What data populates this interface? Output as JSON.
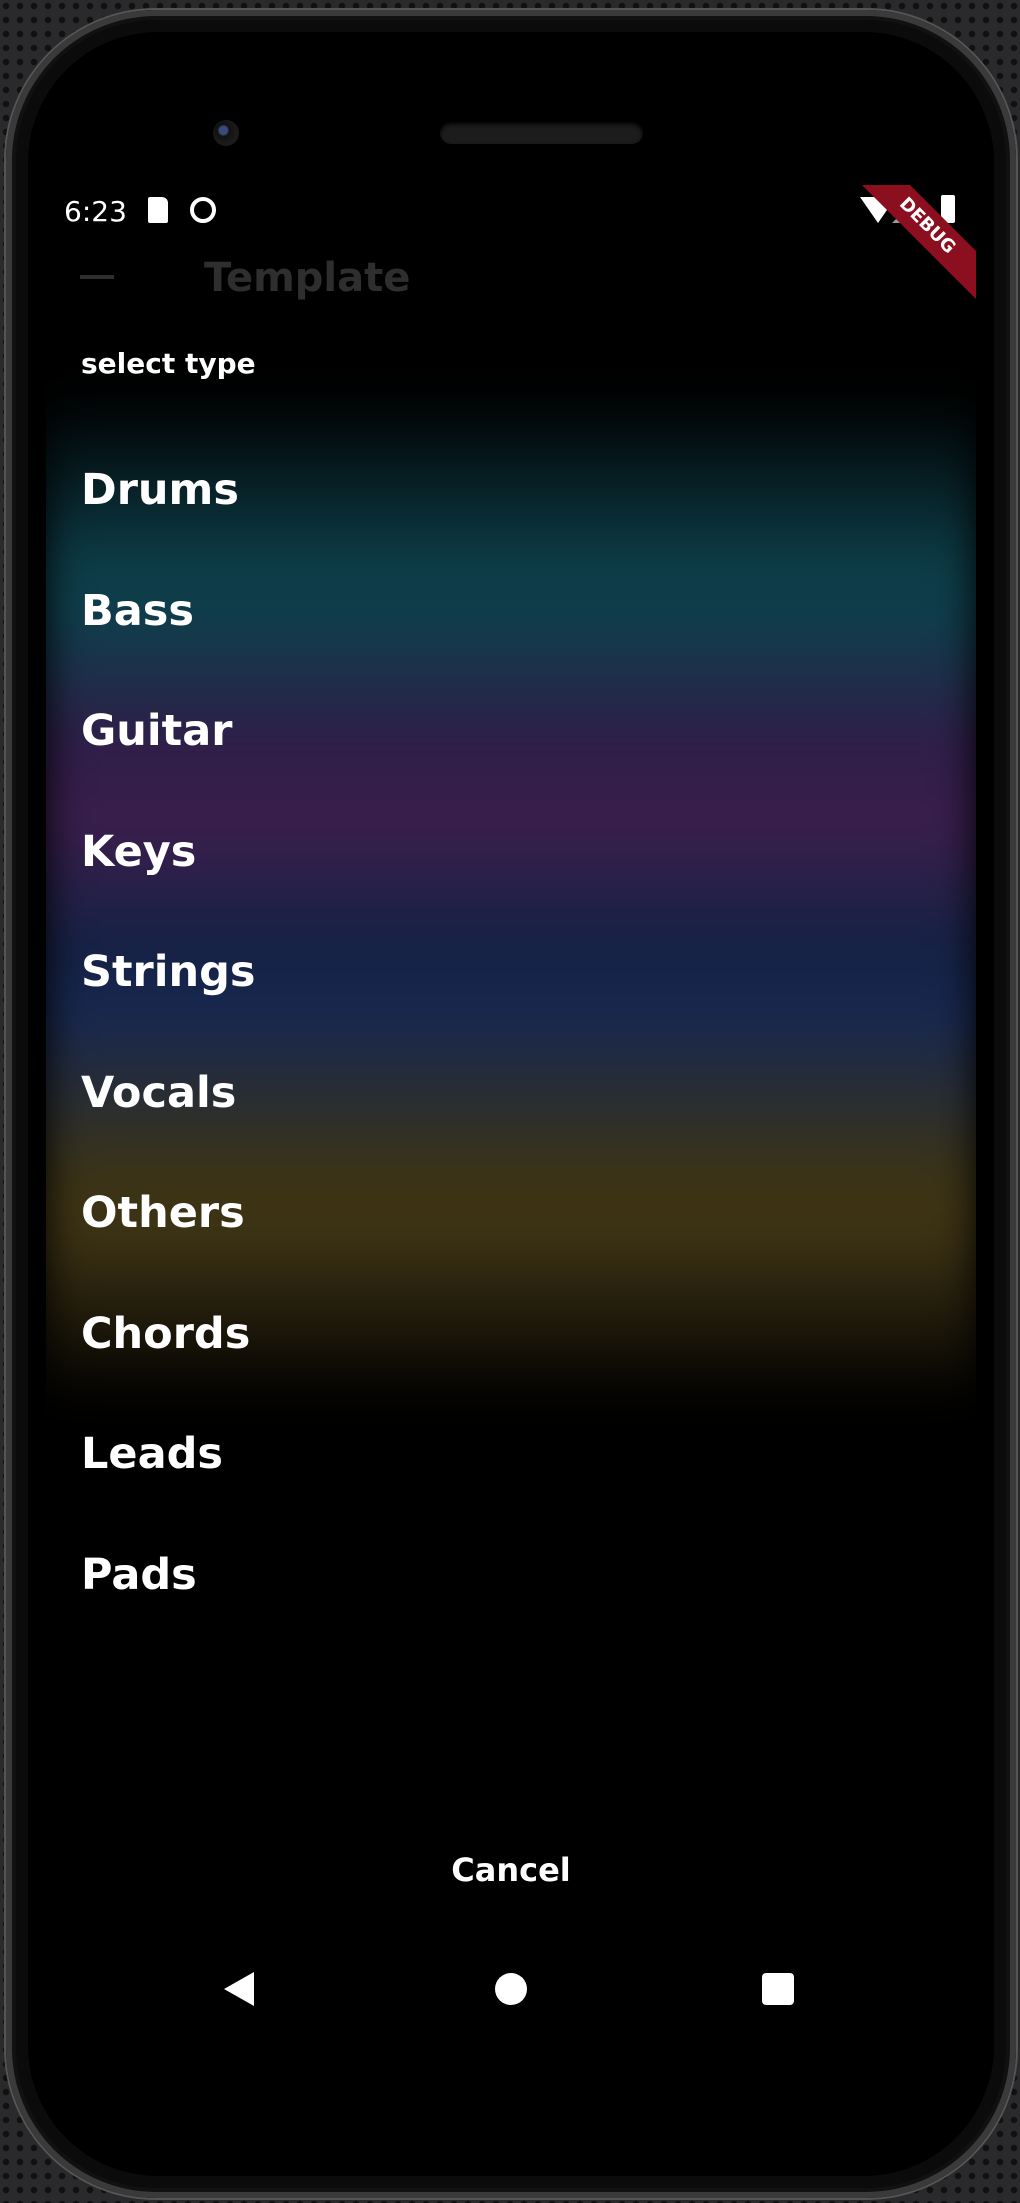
{
  "status_bar": {
    "time": "6:23",
    "icons": [
      "sd-card-icon",
      "sync-icon",
      "wifi-icon",
      "signal-icon",
      "battery-icon"
    ]
  },
  "debug_banner": "DEBUG",
  "app_bar": {
    "title": "Template",
    "back_icon": "arrow-back-icon"
  },
  "dialog": {
    "title": "select type",
    "options": [
      "Drums",
      "Bass",
      "Guitar",
      "Keys",
      "Strings",
      "Vocals",
      "Others",
      "Chords",
      "Leads",
      "Pads"
    ],
    "cancel_label": "Cancel"
  },
  "nav_bar": {
    "icons": [
      "back-triangle-icon",
      "home-circle-icon",
      "recents-square-icon"
    ]
  },
  "colors": {
    "teal_band": "#0e3e4b",
    "purple_band": "#3a1e4c",
    "blue_band": "#17274f",
    "olive_band": "#3d3214",
    "debug_banner": "#8b0f1e"
  }
}
